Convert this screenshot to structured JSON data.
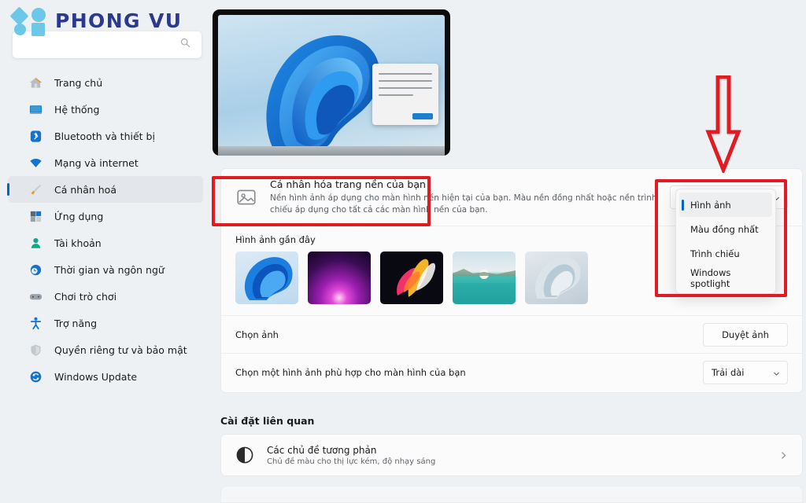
{
  "brand": {
    "name": "PHONG VU",
    "logo_color": "#6cc7e8",
    "text_color": "#2b3a8f"
  },
  "search": {
    "placeholder": "",
    "value": "",
    "icon": "search-icon"
  },
  "sidebar": {
    "items": [
      {
        "label": "Trang chủ",
        "icon": "home-icon",
        "active": false
      },
      {
        "label": "Hệ thống",
        "icon": "monitor-icon",
        "active": false
      },
      {
        "label": "Bluetooth và thiết bị",
        "icon": "bluetooth-icon",
        "active": false
      },
      {
        "label": "Mạng và internet",
        "icon": "wifi-icon",
        "active": false
      },
      {
        "label": "Cá nhân hoá",
        "icon": "brush-icon",
        "active": true
      },
      {
        "label": "Ứng dụng",
        "icon": "apps-icon",
        "active": false
      },
      {
        "label": "Tài khoản",
        "icon": "account-icon",
        "active": false
      },
      {
        "label": "Thời gian và ngôn ngữ",
        "icon": "clock-globe-icon",
        "active": false
      },
      {
        "label": "Chơi trò chơi",
        "icon": "gamepad-icon",
        "active": false
      },
      {
        "label": "Trợ năng",
        "icon": "accessibility-icon",
        "active": false
      },
      {
        "label": "Quyền riêng tư và bảo mật",
        "icon": "shield-icon",
        "active": false
      },
      {
        "label": "Windows Update",
        "icon": "update-icon",
        "active": false
      }
    ]
  },
  "preview": {
    "name": "desktop-preview",
    "wallpaper": "windows-11-bloom"
  },
  "personalize_row": {
    "icon": "image-icon",
    "title": "Cá nhân hóa trang nền của bạn",
    "description": "Nền hình ảnh áp dụng cho màn hình nền hiện tại của bạn. Màu nền đồng nhất hoặc nền trình chiếu áp dụng cho tất cả các màn hình nền của bạn.",
    "select_value": "Hình ảnh"
  },
  "dropdown": {
    "open": true,
    "selected": "Hình ảnh",
    "options": [
      "Hình ảnh",
      "Màu đồng nhất",
      "Trình chiếu",
      "Windows spotlight"
    ]
  },
  "recent": {
    "title": "Hình ảnh gần đây",
    "thumbnails": [
      {
        "name": "wallpaper-bloom-blue",
        "colors": [
          "#bcdcf0",
          "#0b61c9"
        ]
      },
      {
        "name": "wallpaper-purple-glow",
        "colors": [
          "#1b0a28",
          "#c63ad6"
        ]
      },
      {
        "name": "wallpaper-abstract-flow",
        "colors": [
          "#0a0a12",
          "#f3a33c"
        ]
      },
      {
        "name": "wallpaper-lagoon-sunset",
        "colors": [
          "#b9d8e6",
          "#2bb6ad"
        ]
      },
      {
        "name": "wallpaper-white-bloom",
        "colors": [
          "#d6dde2",
          "#b9cbd8"
        ]
      }
    ]
  },
  "choose_image_row": {
    "label": "Chọn ảnh",
    "button": "Duyệt ảnh"
  },
  "fit_row": {
    "label": "Chọn một hình ảnh phù hợp cho màn hình của bạn",
    "select_value": "Trải dài"
  },
  "related": {
    "title": "Cài đặt liên quan",
    "contrast": {
      "icon": "contrast-icon",
      "title": "Các chủ đề tương phản",
      "description": "Chủ đề màu cho thị lực kém, độ nhạy sáng",
      "chevron": "chevron-right-icon"
    }
  },
  "annotations": {
    "color": "#e01b22",
    "boxes": [
      "personalize-row-highlight",
      "dropdown-highlight"
    ],
    "arrow": {
      "name": "down-arrow-annotation",
      "direction": "down"
    }
  }
}
